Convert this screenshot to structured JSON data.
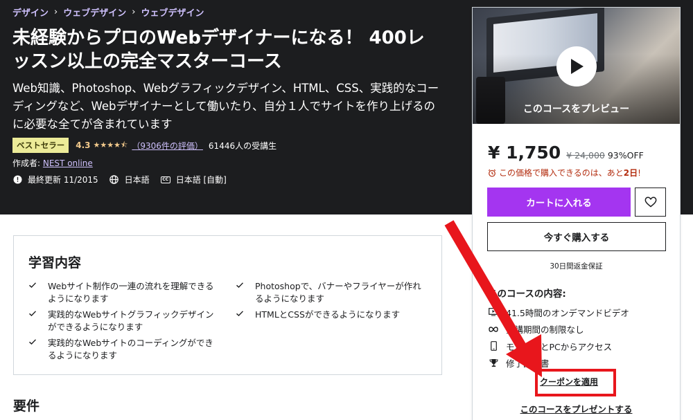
{
  "breadcrumb": [
    "デザイン",
    "ウェブデザイン",
    "ウェブデザイン"
  ],
  "course": {
    "title": "未経験からプロのWebデザイナーになる！ 400レッスン以上の完全マスターコース",
    "subtitle": "Web知識、Photoshop、Webグラフィックデザイン、HTML、CSS、実践的なコーディングなど、Webデザイナーとして働いたり、自分１人でサイトを作り上げるのに必要な全てが含まれています",
    "badge": "ベストセラー",
    "rating": "4.3",
    "rating_count": "（9306件の評価）",
    "students": "61446人の受講生",
    "author_prefix": "作成者:",
    "author": "NEST online",
    "updated": "最終更新 11/2015",
    "language": "日本語",
    "captions": "日本語 [自動]"
  },
  "sidebar": {
    "preview_label": "このコースをプレビュー",
    "price": "¥ 1,750",
    "original_price": "¥ 24,000",
    "discount": "93%OFF",
    "timer_text": "この価格で購入できるのは、あと",
    "timer_days": "2日",
    "timer_suffix": "!",
    "cart_button": "カートに入れる",
    "buy_button": "今すぐ購入する",
    "guarantee": "30日間返金保証",
    "includes_title": "このコースの内容:",
    "includes": [
      {
        "icon": "video-icon",
        "text": "41.5時間のオンデマンドビデオ"
      },
      {
        "icon": "infinity-icon",
        "text": "受講期間の制限なし"
      },
      {
        "icon": "mobile-icon",
        "text": "モバイルとPCからアクセス"
      },
      {
        "icon": "trophy-icon",
        "text": "修了証明書"
      }
    ],
    "coupon": "クーポンを適用",
    "gift": "このコースをプレゼントする"
  },
  "learn": {
    "title": "学習内容",
    "col1": [
      "Webサイト制作の一連の流れを理解できるようになります",
      "実践的なWebサイトグラフィックデザインができるようになります",
      "実践的なWebサイトのコーディングができるようになります"
    ],
    "col2": [
      "Photoshopで、バナーやフライヤーが作れるようになります",
      "HTMLとCSSができるようになります"
    ]
  },
  "requirements_title": "要件",
  "colors": {
    "hero_bg": "#1c1d1f",
    "accent": "#a435f0",
    "link": "#cec0fc",
    "star": "#f3ca8c",
    "badge_bg": "#eceb98",
    "timer": "#b32d0f",
    "annotation": "#e8161c"
  }
}
